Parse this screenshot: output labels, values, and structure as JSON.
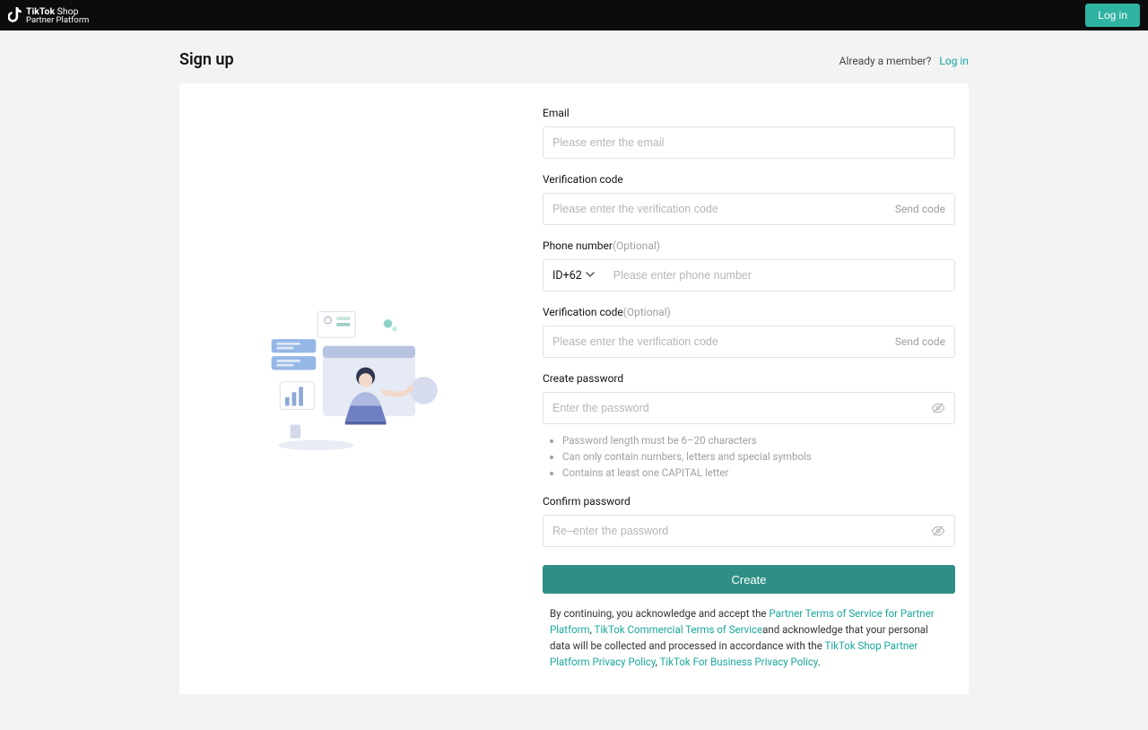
{
  "header": {
    "brand_top_bold": "TikTok",
    "brand_top_rest": " Shop",
    "brand_bottom": "Partner Platform",
    "login_label": "Log in"
  },
  "topline": {
    "title": "Sign up",
    "member_text": "Already a member?",
    "login_link": "Log in"
  },
  "fields": {
    "email": {
      "label": "Email",
      "placeholder": "Please enter the email"
    },
    "vcode1": {
      "label": "Verification code",
      "placeholder": "Please enter the verification code",
      "send": "Send code"
    },
    "phone": {
      "label": "Phone number",
      "optional": "(Optional)",
      "cc": "ID+62",
      "placeholder": "Please enter phone number"
    },
    "vcode2": {
      "label": "Verification code",
      "optional": "(Optional)",
      "placeholder": "Please enter the verification code",
      "send": "Send code"
    },
    "pw": {
      "label": "Create password",
      "placeholder": "Enter the password"
    },
    "rules": [
      "Password length must be 6–20 characters",
      "Can only contain numbers, letters and special symbols",
      "Contains at least one CAPITAL letter"
    ],
    "cpw": {
      "label": "Confirm password",
      "placeholder": "Re–enter the password"
    }
  },
  "submit": {
    "label": "Create"
  },
  "legal": {
    "pre": "By continuing, you acknowledge and accept the ",
    "tos_partner": "Partner Terms of Service for Partner Platform",
    "sep1": ", ",
    "tos_commercial": "TikTok Commercial Terms of Service",
    "mid": "and acknowledge that your personal data will be collected and processed in accordance with the ",
    "pp_shop": "TikTok Shop Partner Platform Privacy Policy",
    "sep2": ", ",
    "pp_biz": "TikTok For Business Privacy Policy",
    "end": "."
  }
}
